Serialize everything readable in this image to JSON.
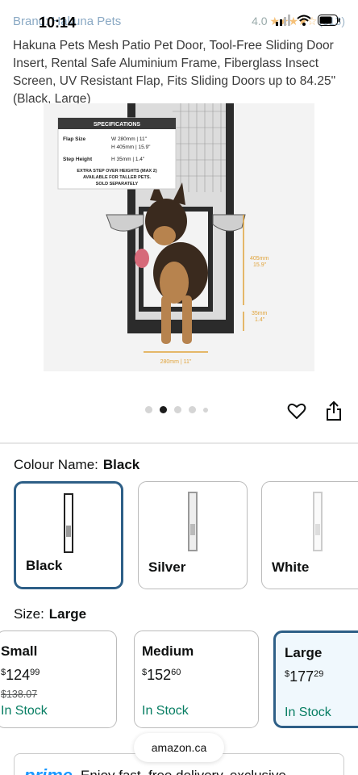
{
  "status": {
    "time": "10:14"
  },
  "brand": {
    "link_text": "Brand: Hakuna Pets",
    "rating": "4.0",
    "review_count": "(313)"
  },
  "product": {
    "title": "Hakuna Pets Mesh Patio Pet Door, Tool-Free Sliding Door Insert, Rental Safe Aluminium Frame, Fiberglass Insect Screen, UV Resistant Flap, Fits Sliding Doors up to 84.25\" (Black, Large)"
  },
  "image": {
    "specs_title": "SPECIFICATIONS",
    "flap_label": "Flap Size",
    "flap_w": "W  280mm | 11\"",
    "flap_h": "H  405mm | 15.9\"",
    "step_label": "Step Height",
    "step_h": "H  35mm | 1.4\"",
    "note1": "EXTRA STEP OVER HEIGHTS (MAX 2)",
    "note2": "AVAILABLE FOR TALLER PETS.",
    "note3": "SOLD SEPARATELY",
    "dim_h1": "405mm",
    "dim_h2": "15.9\"",
    "dim_s1": "35mm",
    "dim_s2": "1.4\"",
    "dim_w": "280mm | 11\"",
    "slide_count": 5,
    "active_slide": 2
  },
  "colour": {
    "label": "Colour Name:",
    "selected": "Black",
    "options": [
      {
        "name": "Black"
      },
      {
        "name": "Silver"
      },
      {
        "name": "White"
      }
    ]
  },
  "size": {
    "label": "Size:",
    "selected": "Large",
    "options": [
      {
        "name": "Small",
        "currency": "$",
        "whole": "124",
        "fraction": "99",
        "was": "$138.07",
        "stock": "In Stock"
      },
      {
        "name": "Medium",
        "currency": "$",
        "whole": "152",
        "fraction": "60",
        "was": "",
        "stock": "In Stock"
      },
      {
        "name": "Large",
        "currency": "$",
        "whole": "177",
        "fraction": "29",
        "was": "",
        "stock": "In Stock"
      }
    ]
  },
  "prime": {
    "logo": "prime",
    "text": "Enjoy fast, free delivery, exclusive"
  },
  "browser": {
    "url": "amazon.ca"
  },
  "colors": {
    "accent": "#2e5f87",
    "in_stock": "#067d62",
    "star": "#f6c27a",
    "prime": "#1a98ff"
  }
}
